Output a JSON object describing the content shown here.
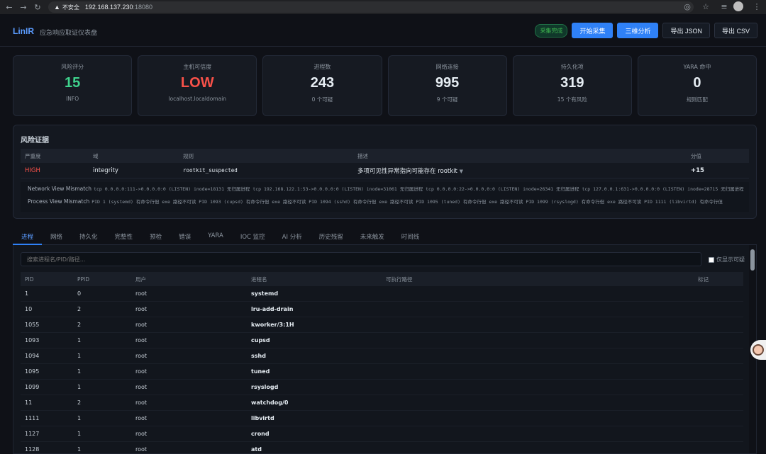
{
  "browser": {
    "insecure_label": "不安全",
    "host": "192.168.137.230",
    "port": ":18080"
  },
  "header": {
    "logo": "LinIR",
    "subtitle": "应急响应取证仪表盘",
    "status_badge": "采集完成",
    "btn_start": "开始采集",
    "btn_analyze": "三维分析",
    "btn_json": "导出 JSON",
    "btn_csv": "导出 CSV"
  },
  "cards": [
    {
      "label": "风险评分",
      "value": "15",
      "sub": "INFO"
    },
    {
      "label": "主机可信度",
      "value": "LOW",
      "sub": "localhost.localdomain"
    },
    {
      "label": "进程数",
      "value": "243",
      "sub": "0 个可疑"
    },
    {
      "label": "网络连接",
      "value": "995",
      "sub": "9 个可疑"
    },
    {
      "label": "持久化项",
      "value": "319",
      "sub": "15 个有风险"
    },
    {
      "label": "YARA 命中",
      "value": "0",
      "sub": "规则匹配"
    }
  ],
  "evidence": {
    "title": "风险证据",
    "columns": [
      "严重度",
      "域",
      "规则",
      "描述",
      "分值"
    ],
    "row": {
      "severity": "HIGH",
      "domain": "integrity",
      "rule": "rootkit_suspected",
      "description": "多项可见性异常指向可能存在 rootkit",
      "caret": "▼",
      "score": "+15"
    },
    "details": [
      {
        "key": "Network View Mismatch",
        "value": "tcp 0.0.0.0:111->0.0.0.0:0 (LISTEN) inode=18131 无归属进程  tcp 192.168.122.1:53->0.0.0.0:0 (LISTEN) inode=31061 无归属进程  tcp 0.0.0.0:22->0.0.0.0:0 (LISTEN) inode=26341 无归属进程  tcp 127.0.0.1:631->0.0.0.0:0 (LISTEN) inode=28715 无归属进程"
      },
      {
        "key": "Process View Mismatch",
        "value": "PID 1 (systemd) 有命令行但 exe 路径不可读  PID 1093 (cupsd) 有命令行但 exe 路径不可读  PID 1094 (sshd) 有命令行但 exe 路径不可读  PID 1095 (tuned) 有命令行但 exe 路径不可读  PID 1099 (rsyslogd) 有命令行但 exe 路径不可读  PID 1111 (libvirtd) 有命令行但"
      }
    ]
  },
  "tabs": [
    "进程",
    "网络",
    "持久化",
    "完整性",
    "预检",
    "错误",
    "YARA",
    "IOC 监控",
    "AI 分析",
    "历史残留",
    "未来触发",
    "时间线"
  ],
  "process": {
    "search_placeholder": "搜索进程名/PID/路径...",
    "only_suspicious": "仅显示可疑",
    "columns": [
      "PID",
      "PPID",
      "用户",
      "进程名",
      "可执行路径",
      "标记"
    ],
    "rows": [
      {
        "pid": "1",
        "ppid": "0",
        "user": "root",
        "name": "systemd",
        "exe": "",
        "flag": ""
      },
      {
        "pid": "10",
        "ppid": "2",
        "user": "root",
        "name": "lru-add-drain",
        "exe": "",
        "flag": ""
      },
      {
        "pid": "1055",
        "ppid": "2",
        "user": "root",
        "name": "kworker/3:1H",
        "exe": "",
        "flag": ""
      },
      {
        "pid": "1093",
        "ppid": "1",
        "user": "root",
        "name": "cupsd",
        "exe": "",
        "flag": ""
      },
      {
        "pid": "1094",
        "ppid": "1",
        "user": "root",
        "name": "sshd",
        "exe": "",
        "flag": ""
      },
      {
        "pid": "1095",
        "ppid": "1",
        "user": "root",
        "name": "tuned",
        "exe": "",
        "flag": ""
      },
      {
        "pid": "1099",
        "ppid": "1",
        "user": "root",
        "name": "rsyslogd",
        "exe": "",
        "flag": ""
      },
      {
        "pid": "11",
        "ppid": "2",
        "user": "root",
        "name": "watchdog/0",
        "exe": "",
        "flag": ""
      },
      {
        "pid": "1111",
        "ppid": "1",
        "user": "root",
        "name": "libvirtd",
        "exe": "",
        "flag": ""
      },
      {
        "pid": "1127",
        "ppid": "1",
        "user": "root",
        "name": "crond",
        "exe": "",
        "flag": ""
      },
      {
        "pid": "1128",
        "ppid": "1",
        "user": "root",
        "name": "atd",
        "exe": "",
        "flag": ""
      }
    ]
  }
}
